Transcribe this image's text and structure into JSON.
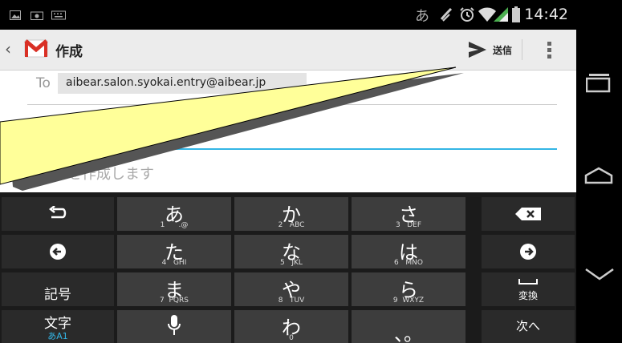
{
  "status_bar": {
    "time": "14:42",
    "ime_indicator": "あ",
    "icons": [
      "image-icon",
      "camera-icon",
      "keyboard-icon",
      "nfc-icon",
      "alarm-icon",
      "wifi-icon",
      "signal-icon",
      "battery-icon"
    ]
  },
  "action_bar": {
    "title": "作成",
    "send_label": "送信"
  },
  "compose": {
    "to_label": "To",
    "to_recipient": "aibear.salon.syokai.entry@aibear.jp",
    "body_placeholder": "メールを作成します"
  },
  "keyboard": {
    "rows": [
      [
        {
          "type": "icon",
          "name": "undo-icon"
        },
        {
          "main": "あ",
          "sub": "1      .@"
        },
        {
          "main": "か",
          "sub": "2   ABC"
        },
        {
          "main": "さ",
          "sub": "3   DEF"
        },
        {
          "type": "icon",
          "name": "backspace-icon"
        }
      ],
      [
        {
          "type": "icon",
          "name": "left-arrow-icon"
        },
        {
          "main": "た",
          "sub": "4   GHI"
        },
        {
          "main": "な",
          "sub": "5   JKL"
        },
        {
          "main": "は",
          "sub": "6   MNO"
        },
        {
          "type": "icon",
          "name": "right-arrow-icon"
        }
      ],
      [
        {
          "label": "記号"
        },
        {
          "main": "ま",
          "sub": "7  PQRS"
        },
        {
          "main": "や",
          "sub": "8   TUV"
        },
        {
          "main": "ら",
          "sub": "9  WXYZ"
        },
        {
          "label": "変換"
        }
      ],
      [
        {
          "label": "文字",
          "sub": "あA1"
        },
        {
          "type": "icon",
          "name": "mic-icon"
        },
        {
          "main": "わ",
          "sub": "0"
        },
        {
          "main": "、。"
        },
        {
          "label": "次へ"
        }
      ]
    ]
  },
  "colors": {
    "accent": "#33b5e5",
    "callout_fill": "#ffff99",
    "gmail_red": "#d93025"
  }
}
